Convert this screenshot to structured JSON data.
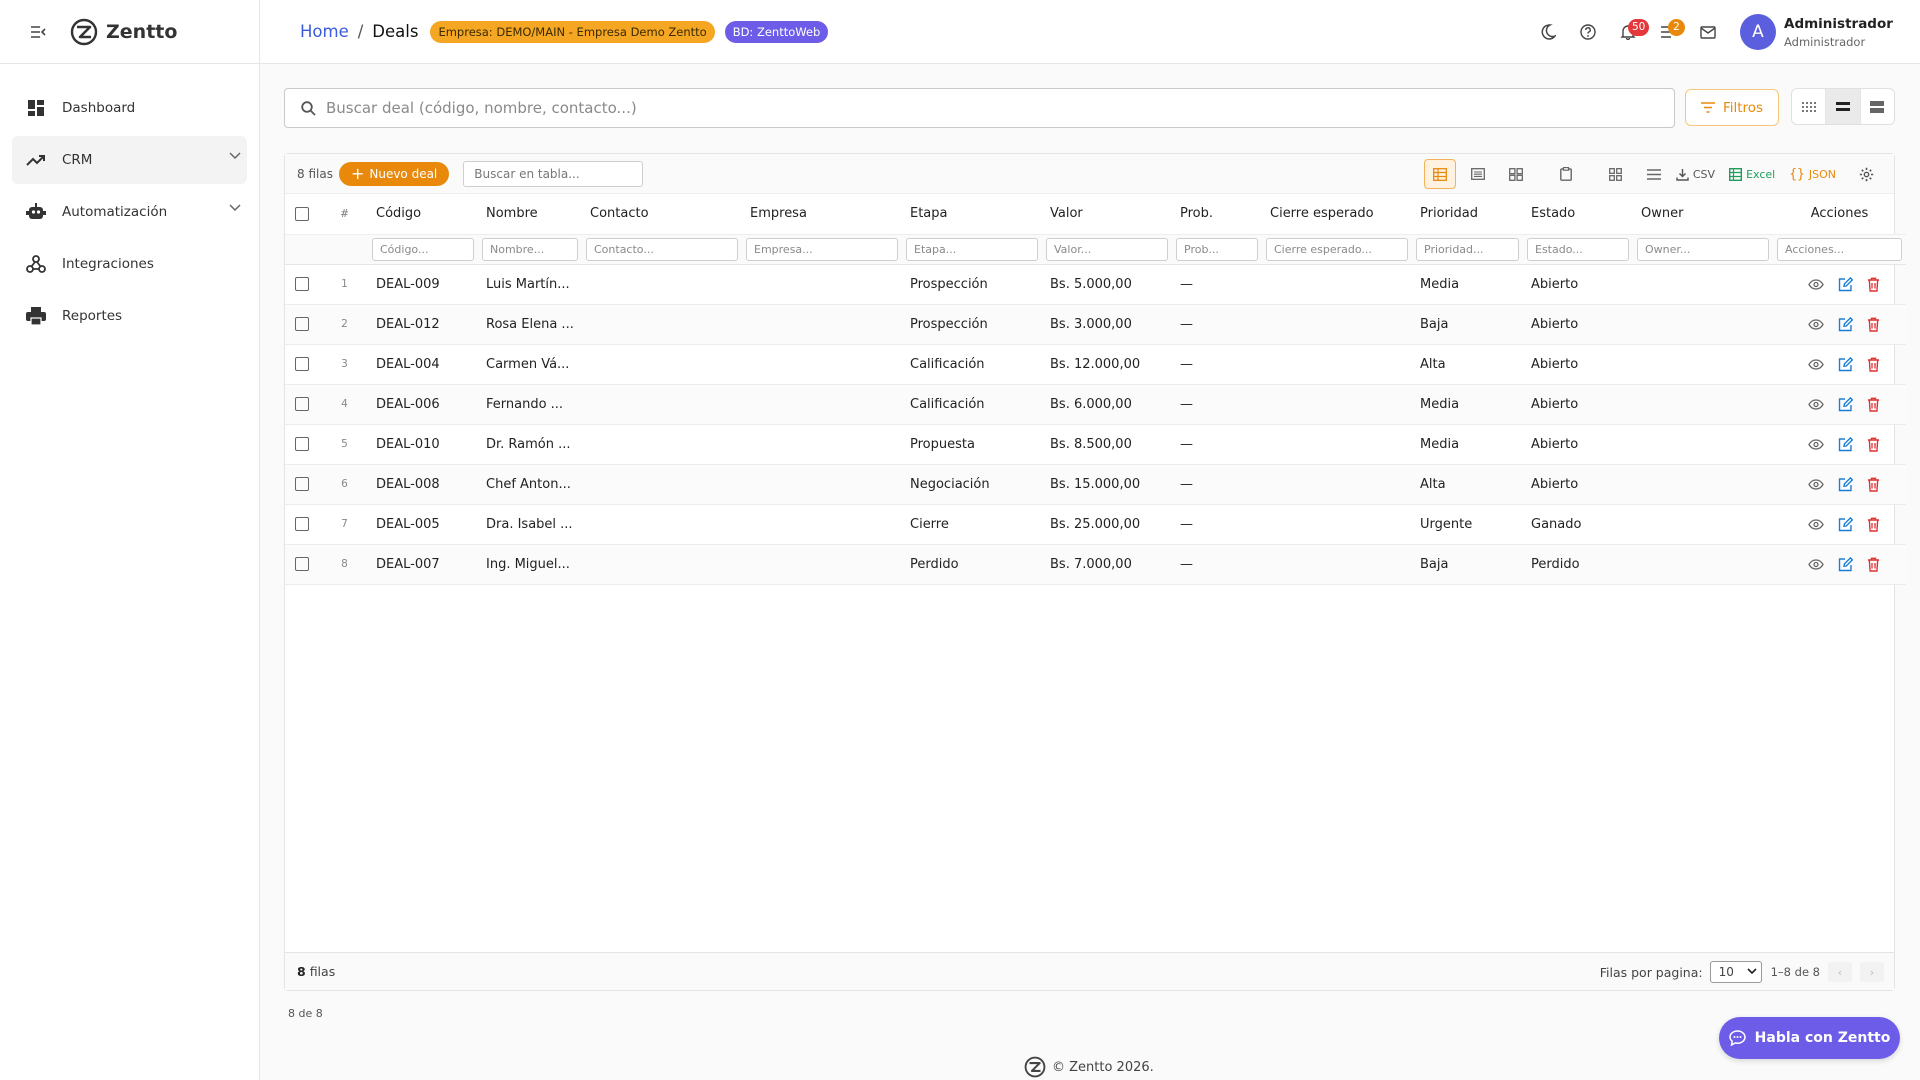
{
  "app": {
    "name": "Zentto",
    "copyright": "© Zentto 2026."
  },
  "sidebar": {
    "items": [
      {
        "label": "Dashboard",
        "icon": "dashboard-icon"
      },
      {
        "label": "CRM",
        "icon": "trending-up-icon",
        "active": true,
        "expandable": true
      },
      {
        "label": "Automatización",
        "icon": "robot-icon",
        "expandable": true
      },
      {
        "label": "Integraciones",
        "icon": "webhook-icon"
      },
      {
        "label": "Reportes",
        "icon": "printer-icon"
      }
    ]
  },
  "header": {
    "breadcrumb": {
      "home": "Home",
      "sep": "/",
      "current": "Deals"
    },
    "company_chip": "Empresa: DEMO/MAIN - Empresa Demo Zentto",
    "db_chip": "BD: ZenttoWeb",
    "notifications_count": "50",
    "tasks_count": "2",
    "avatar_initial": "A",
    "user_name": "Administrador",
    "user_role": "Administrador"
  },
  "search": {
    "placeholder": "Buscar deal (código, nombre, contacto...)",
    "value": ""
  },
  "filters_label": "Filtros",
  "grid": {
    "row_count_label": "8 filas",
    "new_button": "Nuevo deal",
    "table_search_placeholder": "Buscar en tabla...",
    "export": {
      "csv": "CSV",
      "excel": "Excel",
      "json": "JSON"
    },
    "index_header": "#",
    "columns": [
      {
        "label": "Código",
        "filter": "Código..."
      },
      {
        "label": "Nombre",
        "filter": "Nombre..."
      },
      {
        "label": "Contacto",
        "filter": "Contacto..."
      },
      {
        "label": "Empresa",
        "filter": "Empresa..."
      },
      {
        "label": "Etapa",
        "filter": "Etapa..."
      },
      {
        "label": "Valor",
        "filter": "Valor..."
      },
      {
        "label": "Prob.",
        "filter": "Prob..."
      },
      {
        "label": "Cierre esperado",
        "filter": "Cierre esperado..."
      },
      {
        "label": "Prioridad",
        "filter": "Prioridad..."
      },
      {
        "label": "Estado",
        "filter": "Estado..."
      },
      {
        "label": "Owner",
        "filter": "Owner..."
      },
      {
        "label": "Acciones",
        "filter": "Acciones..."
      }
    ],
    "rows": [
      {
        "idx": "1",
        "codigo": "DEAL-009",
        "nombre": "Luis Martín...",
        "contacto": "",
        "empresa": "",
        "etapa": "Prospección",
        "valor": "Bs. 5.000,00",
        "prob": "—",
        "cierre": "",
        "prioridad": "Media",
        "estado": "Abierto",
        "owner": ""
      },
      {
        "idx": "2",
        "codigo": "DEAL-012",
        "nombre": "Rosa Elena ...",
        "contacto": "",
        "empresa": "",
        "etapa": "Prospección",
        "valor": "Bs. 3.000,00",
        "prob": "—",
        "cierre": "",
        "prioridad": "Baja",
        "estado": "Abierto",
        "owner": ""
      },
      {
        "idx": "3",
        "codigo": "DEAL-004",
        "nombre": "Carmen Vá...",
        "contacto": "",
        "empresa": "",
        "etapa": "Calificación",
        "valor": "Bs. 12.000,00",
        "prob": "—",
        "cierre": "",
        "prioridad": "Alta",
        "estado": "Abierto",
        "owner": ""
      },
      {
        "idx": "4",
        "codigo": "DEAL-006",
        "nombre": "Fernando ...",
        "contacto": "",
        "empresa": "",
        "etapa": "Calificación",
        "valor": "Bs. 6.000,00",
        "prob": "—",
        "cierre": "",
        "prioridad": "Media",
        "estado": "Abierto",
        "owner": ""
      },
      {
        "idx": "5",
        "codigo": "DEAL-010",
        "nombre": "Dr. Ramón ...",
        "contacto": "",
        "empresa": "",
        "etapa": "Propuesta",
        "valor": "Bs. 8.500,00",
        "prob": "—",
        "cierre": "",
        "prioridad": "Media",
        "estado": "Abierto",
        "owner": ""
      },
      {
        "idx": "6",
        "codigo": "DEAL-008",
        "nombre": "Chef Anton...",
        "contacto": "",
        "empresa": "",
        "etapa": "Negociación",
        "valor": "Bs. 15.000,00",
        "prob": "—",
        "cierre": "",
        "prioridad": "Alta",
        "estado": "Abierto",
        "owner": ""
      },
      {
        "idx": "7",
        "codigo": "DEAL-005",
        "nombre": "Dra. Isabel ...",
        "contacto": "",
        "empresa": "",
        "etapa": "Cierre",
        "valor": "Bs. 25.000,00",
        "prob": "—",
        "cierre": "",
        "prioridad": "Urgente",
        "estado": "Ganado",
        "owner": ""
      },
      {
        "idx": "8",
        "codigo": "DEAL-007",
        "nombre": "Ing. Miguel...",
        "contacto": "",
        "empresa": "",
        "etapa": "Perdido",
        "valor": "Bs. 7.000,00",
        "prob": "—",
        "cierre": "",
        "prioridad": "Baja",
        "estado": "Perdido",
        "owner": ""
      }
    ],
    "footer": {
      "count": "8",
      "count_suffix": "filas",
      "rows_per_page_label": "Filas por pagina:",
      "rows_per_page": "10",
      "range": "1–8 de 8"
    },
    "below_label": "8 de 8"
  },
  "chat_button": "Habla con Zentto",
  "colors": {
    "accent": "#e8890c",
    "primary": "#6c5ce7",
    "link": "#3b5bdb",
    "danger": "#e03131"
  }
}
